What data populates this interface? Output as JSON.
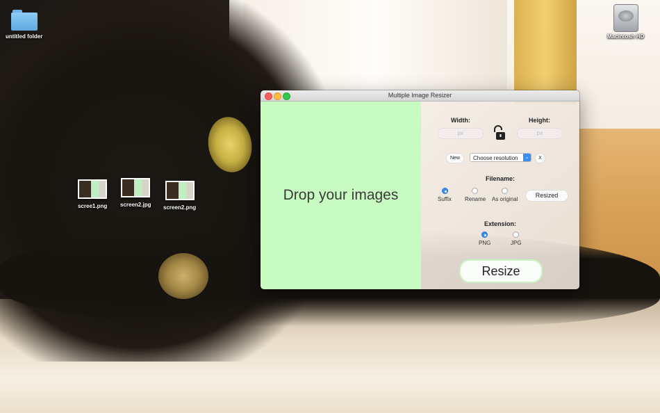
{
  "desktop": {
    "folder_label": "untitled folder",
    "hd_label": "Macintosh HD",
    "files": [
      "scree1.png",
      "screen2.jpg",
      "screen2.png"
    ]
  },
  "window": {
    "title": "Multiple Image Resizer",
    "drop_text": "Drop your images",
    "width_label": "Width:",
    "height_label": "Height:",
    "width_placeholder": "px",
    "height_placeholder": "px",
    "new_label": "New",
    "resolution_value": "Choose resolution",
    "clear_label": "X",
    "filename_label": "Filename:",
    "filename_options": [
      "Suffix",
      "Rename",
      "As original"
    ],
    "filename_selected": "Suffix",
    "suffix_value": "Resized",
    "extension_label": "Extension:",
    "extension_options": [
      "PNG",
      "JPG"
    ],
    "extension_selected": "PNG",
    "resize_label": "Resize"
  },
  "colors": {
    "drop_zone": "#c8fbc1",
    "accent": "#3b8ef0"
  }
}
